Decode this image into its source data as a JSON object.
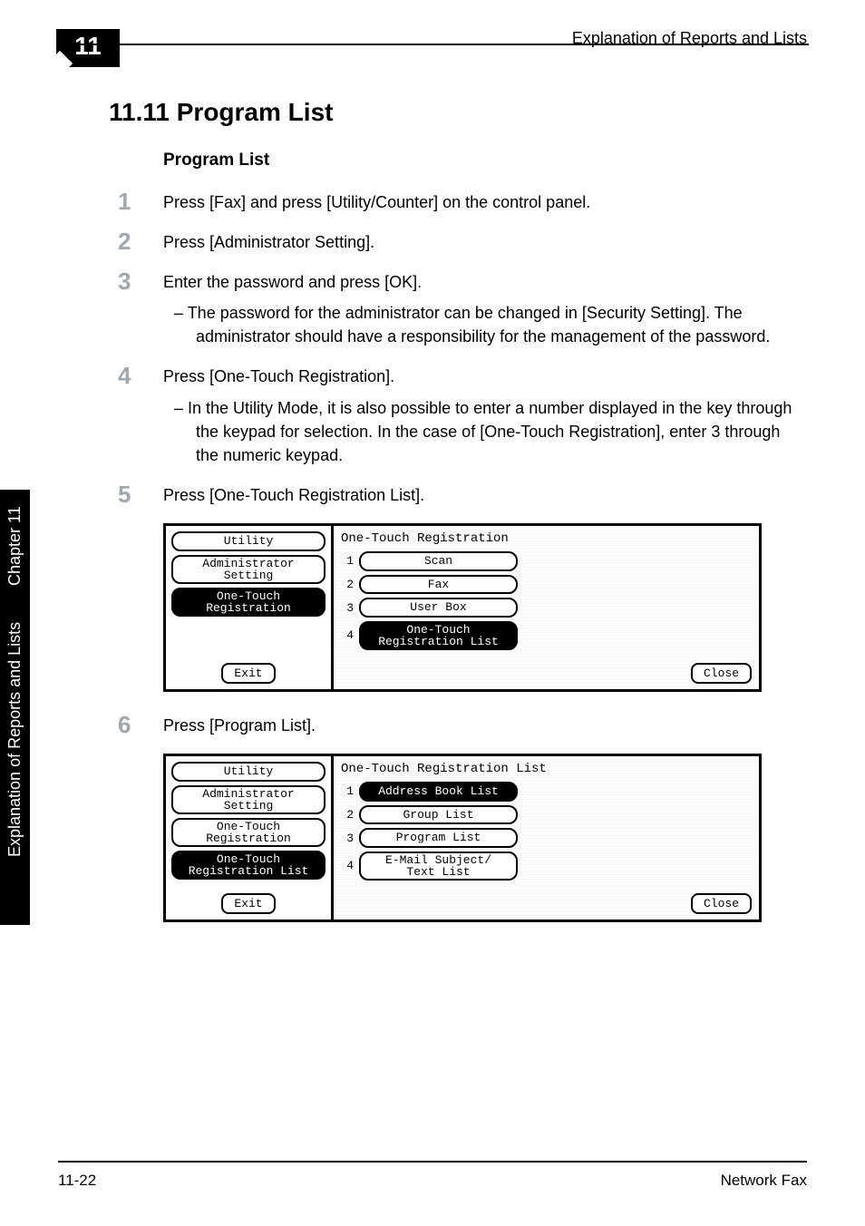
{
  "header": {
    "chapter_number": "11",
    "section_title": "Explanation of Reports and Lists"
  },
  "sidebar": {
    "text": "Explanation of Reports and Lists",
    "chapter_label": "Chapter 11"
  },
  "section": {
    "heading": "11.11 Program List",
    "subheading": "Program List"
  },
  "steps": [
    {
      "num": "1",
      "text": "Press [Fax] and press [Utility/Counter] on the control panel."
    },
    {
      "num": "2",
      "text": "Press [Administrator Setting]."
    },
    {
      "num": "3",
      "text": "Enter the password and press [OK].",
      "sub": "The password for the administrator can be changed in [Security Setting]. The administrator should have a responsibility for the management of the password."
    },
    {
      "num": "4",
      "text": "Press [One-Touch Registration].",
      "sub": "In the Utility Mode, it is also possible to enter a number displayed in the key through the keypad for selection. In the case of [One-Touch Registration], enter 3 through the numeric keypad."
    },
    {
      "num": "5",
      "text": "Press [One-Touch Registration List]."
    },
    {
      "num": "6",
      "text": "Press [Program List]."
    }
  ],
  "shot1": {
    "left": {
      "utility": "Utility",
      "admin": "Administrator\nSetting",
      "onetouch": "One-Touch\nRegistration",
      "exit": "Exit"
    },
    "title": "One-Touch Registration",
    "items": [
      {
        "n": "1",
        "label": "Scan"
      },
      {
        "n": "2",
        "label": "Fax"
      },
      {
        "n": "3",
        "label": "User Box"
      },
      {
        "n": "4",
        "label": "One-Touch\nRegistration List"
      }
    ],
    "close": "Close"
  },
  "shot2": {
    "left": {
      "utility": "Utility",
      "admin": "Administrator\nSetting",
      "onetouch": "One-Touch\nRegistration",
      "reglist": "One-Touch\nRegistration List",
      "exit": "Exit"
    },
    "title": "One-Touch Registration List",
    "items": [
      {
        "n": "1",
        "label": "Address Book List"
      },
      {
        "n": "2",
        "label": "Group List"
      },
      {
        "n": "3",
        "label": "Program List"
      },
      {
        "n": "4",
        "label": "E-Mail Subject/\nText List"
      }
    ],
    "close": "Close"
  },
  "footer": {
    "page": "11-22",
    "doc": "Network Fax"
  }
}
